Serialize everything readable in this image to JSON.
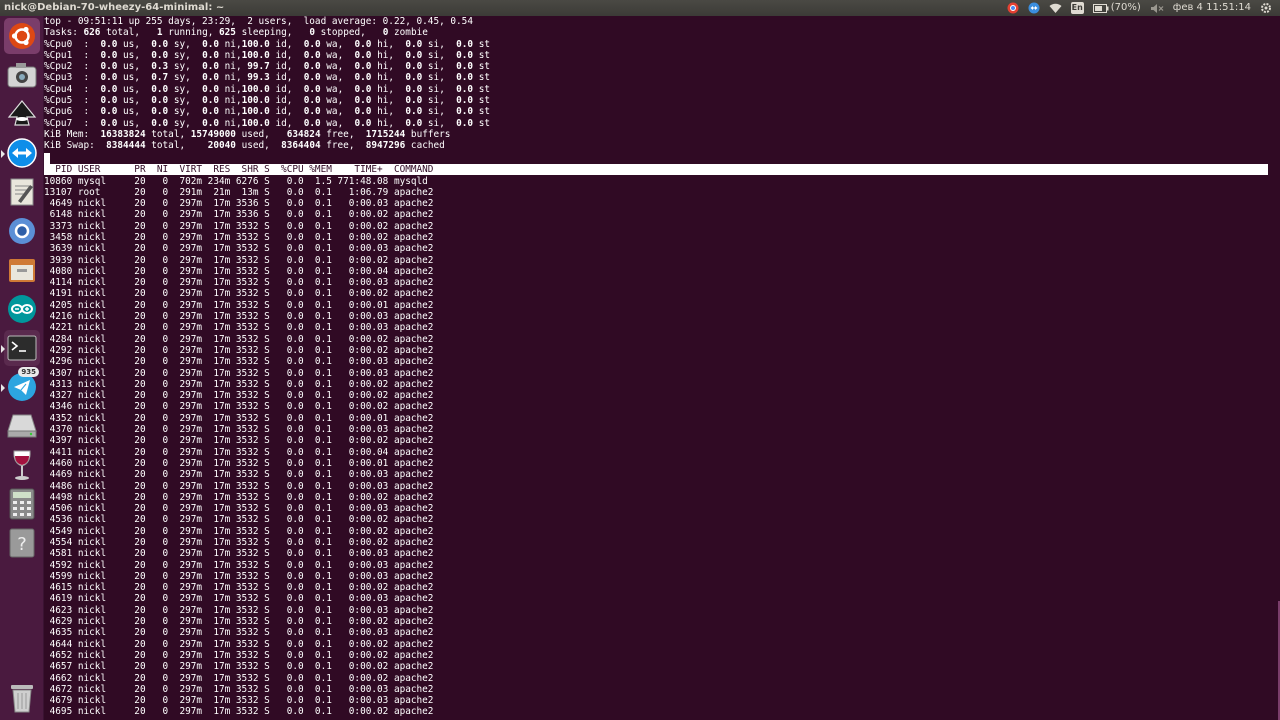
{
  "window": {
    "title": "nick@Debian-70-wheezy-64-minimal: ~"
  },
  "panel": {
    "battery": "(70%)",
    "keyboard_layout": "En",
    "datetime": "фев 4 11:51:14",
    "indicators": [
      "chrome-indicator-icon",
      "teamviewer-indicator-icon",
      "wifi-icon",
      "keyboard-layout-icon",
      "battery-icon",
      "volume-muted-icon",
      "power-gear-icon"
    ]
  },
  "launcher": {
    "items": [
      {
        "name": "ubuntu-dash-icon",
        "color": "#dd4814"
      },
      {
        "name": "screenshot-camera-icon",
        "color": "#9e9e9e"
      },
      {
        "name": "inkscape-icon",
        "color": "#222222"
      },
      {
        "name": "teamviewer-icon",
        "color": "#0e8ee9"
      },
      {
        "name": "text-editor-icon",
        "color": "#d8d4c8"
      },
      {
        "name": "chromium-icon",
        "color": "#5b8fd6"
      },
      {
        "name": "file-manager-icon",
        "color": "#cf7a36"
      },
      {
        "name": "arduino-icon",
        "color": "#00979c"
      },
      {
        "name": "terminal-icon",
        "color": "#2c2c2c"
      },
      {
        "name": "telegram-icon",
        "color": "#2ca5e0",
        "badge": "935"
      },
      {
        "name": "drive-icon",
        "color": "#bdbdbd"
      },
      {
        "name": "wine-icon",
        "color": "#e0e0e0"
      },
      {
        "name": "calculator-icon",
        "color": "#8a8a8a"
      },
      {
        "name": "help-icon",
        "color": "#9a9a9a"
      },
      {
        "name": "trash-icon",
        "color": "#aaaaaa"
      }
    ]
  },
  "top": {
    "summary_lines": [
      "top - 09:51:11 up 255 days, 23:29,  2 users,  load average: 0.22, 0.45, 0.54",
      "Tasks: 626 total,   1 running, 625 sleeping,   0 stopped,   0 zombie",
      "%Cpu0  :  0.0 us,  0.0 sy,  0.0 ni,100.0 id,  0.0 wa,  0.0 hi,  0.0 si,  0.0 st",
      "%Cpu1  :  0.0 us,  0.0 sy,  0.0 ni,100.0 id,  0.0 wa,  0.0 hi,  0.0 si,  0.0 st",
      "%Cpu2  :  0.0 us,  0.3 sy,  0.0 ni, 99.7 id,  0.0 wa,  0.0 hi,  0.0 si,  0.0 st",
      "%Cpu3  :  0.0 us,  0.7 sy,  0.0 ni, 99.3 id,  0.0 wa,  0.0 hi,  0.0 si,  0.0 st",
      "%Cpu4  :  0.0 us,  0.0 sy,  0.0 ni,100.0 id,  0.0 wa,  0.0 hi,  0.0 si,  0.0 st",
      "%Cpu5  :  0.0 us,  0.0 sy,  0.0 ni,100.0 id,  0.0 wa,  0.0 hi,  0.0 si,  0.0 st",
      "%Cpu6  :  0.0 us,  0.0 sy,  0.0 ni,100.0 id,  0.0 wa,  0.0 hi,  0.0 si,  0.0 st",
      "%Cpu7  :  0.0 us,  0.0 sy,  0.0 ni,100.0 id,  0.0 wa,  0.0 hi,  0.0 si,  0.0 st",
      "KiB Mem:  16383824 total, 15749000 used,   634824 free,  1715244 buffers",
      "KiB Swap:  8384444 total,    20040 used,  8364404 free,  8947296 cached"
    ],
    "header": "  PID USER      PR  NI  VIRT  RES  SHR S  %CPU %MEM    TIME+  COMMAND",
    "processes": [
      {
        "pid": "10860",
        "user": "mysql",
        "pr": "20",
        "ni": "0",
        "virt": "702m",
        "res": "234m",
        "shr": "6276",
        "s": "S",
        "cpu": "0.0",
        "mem": "1.5",
        "time": "771:48.08",
        "command": "mysqld"
      },
      {
        "pid": "13107",
        "user": "root",
        "pr": "20",
        "ni": "0",
        "virt": "291m",
        "res": "21m",
        "shr": "13m",
        "s": "S",
        "cpu": "0.0",
        "mem": "0.1",
        "time": "1:06.79",
        "command": "apache2"
      },
      {
        "pid": "4649",
        "user": "nickl",
        "pr": "20",
        "ni": "0",
        "virt": "297m",
        "res": "17m",
        "shr": "3536",
        "s": "S",
        "cpu": "0.0",
        "mem": "0.1",
        "time": "0:00.03",
        "command": "apache2"
      },
      {
        "pid": "6148",
        "user": "nickl",
        "pr": "20",
        "ni": "0",
        "virt": "297m",
        "res": "17m",
        "shr": "3536",
        "s": "S",
        "cpu": "0.0",
        "mem": "0.1",
        "time": "0:00.02",
        "command": "apache2"
      },
      {
        "pid": "3373",
        "user": "nickl",
        "pr": "20",
        "ni": "0",
        "virt": "297m",
        "res": "17m",
        "shr": "3532",
        "s": "S",
        "cpu": "0.0",
        "mem": "0.1",
        "time": "0:00.02",
        "command": "apache2"
      },
      {
        "pid": "3458",
        "user": "nickl",
        "pr": "20",
        "ni": "0",
        "virt": "297m",
        "res": "17m",
        "shr": "3532",
        "s": "S",
        "cpu": "0.0",
        "mem": "0.1",
        "time": "0:00.02",
        "command": "apache2"
      },
      {
        "pid": "3639",
        "user": "nickl",
        "pr": "20",
        "ni": "0",
        "virt": "297m",
        "res": "17m",
        "shr": "3532",
        "s": "S",
        "cpu": "0.0",
        "mem": "0.1",
        "time": "0:00.03",
        "command": "apache2"
      },
      {
        "pid": "3939",
        "user": "nickl",
        "pr": "20",
        "ni": "0",
        "virt": "297m",
        "res": "17m",
        "shr": "3532",
        "s": "S",
        "cpu": "0.0",
        "mem": "0.1",
        "time": "0:00.02",
        "command": "apache2"
      },
      {
        "pid": "4080",
        "user": "nickl",
        "pr": "20",
        "ni": "0",
        "virt": "297m",
        "res": "17m",
        "shr": "3532",
        "s": "S",
        "cpu": "0.0",
        "mem": "0.1",
        "time": "0:00.04",
        "command": "apache2"
      },
      {
        "pid": "4114",
        "user": "nickl",
        "pr": "20",
        "ni": "0",
        "virt": "297m",
        "res": "17m",
        "shr": "3532",
        "s": "S",
        "cpu": "0.0",
        "mem": "0.1",
        "time": "0:00.03",
        "command": "apache2"
      },
      {
        "pid": "4191",
        "user": "nickl",
        "pr": "20",
        "ni": "0",
        "virt": "297m",
        "res": "17m",
        "shr": "3532",
        "s": "S",
        "cpu": "0.0",
        "mem": "0.1",
        "time": "0:00.02",
        "command": "apache2"
      },
      {
        "pid": "4205",
        "user": "nickl",
        "pr": "20",
        "ni": "0",
        "virt": "297m",
        "res": "17m",
        "shr": "3532",
        "s": "S",
        "cpu": "0.0",
        "mem": "0.1",
        "time": "0:00.01",
        "command": "apache2"
      },
      {
        "pid": "4216",
        "user": "nickl",
        "pr": "20",
        "ni": "0",
        "virt": "297m",
        "res": "17m",
        "shr": "3532",
        "s": "S",
        "cpu": "0.0",
        "mem": "0.1",
        "time": "0:00.03",
        "command": "apache2"
      },
      {
        "pid": "4221",
        "user": "nickl",
        "pr": "20",
        "ni": "0",
        "virt": "297m",
        "res": "17m",
        "shr": "3532",
        "s": "S",
        "cpu": "0.0",
        "mem": "0.1",
        "time": "0:00.03",
        "command": "apache2"
      },
      {
        "pid": "4284",
        "user": "nickl",
        "pr": "20",
        "ni": "0",
        "virt": "297m",
        "res": "17m",
        "shr": "3532",
        "s": "S",
        "cpu": "0.0",
        "mem": "0.1",
        "time": "0:00.02",
        "command": "apache2"
      },
      {
        "pid": "4292",
        "user": "nickl",
        "pr": "20",
        "ni": "0",
        "virt": "297m",
        "res": "17m",
        "shr": "3532",
        "s": "S",
        "cpu": "0.0",
        "mem": "0.1",
        "time": "0:00.02",
        "command": "apache2"
      },
      {
        "pid": "4296",
        "user": "nickl",
        "pr": "20",
        "ni": "0",
        "virt": "297m",
        "res": "17m",
        "shr": "3532",
        "s": "S",
        "cpu": "0.0",
        "mem": "0.1",
        "time": "0:00.03",
        "command": "apache2"
      },
      {
        "pid": "4307",
        "user": "nickl",
        "pr": "20",
        "ni": "0",
        "virt": "297m",
        "res": "17m",
        "shr": "3532",
        "s": "S",
        "cpu": "0.0",
        "mem": "0.1",
        "time": "0:00.03",
        "command": "apache2"
      },
      {
        "pid": "4313",
        "user": "nickl",
        "pr": "20",
        "ni": "0",
        "virt": "297m",
        "res": "17m",
        "shr": "3532",
        "s": "S",
        "cpu": "0.0",
        "mem": "0.1",
        "time": "0:00.02",
        "command": "apache2"
      },
      {
        "pid": "4327",
        "user": "nickl",
        "pr": "20",
        "ni": "0",
        "virt": "297m",
        "res": "17m",
        "shr": "3532",
        "s": "S",
        "cpu": "0.0",
        "mem": "0.1",
        "time": "0:00.02",
        "command": "apache2"
      },
      {
        "pid": "4346",
        "user": "nickl",
        "pr": "20",
        "ni": "0",
        "virt": "297m",
        "res": "17m",
        "shr": "3532",
        "s": "S",
        "cpu": "0.0",
        "mem": "0.1",
        "time": "0:00.02",
        "command": "apache2"
      },
      {
        "pid": "4352",
        "user": "nickl",
        "pr": "20",
        "ni": "0",
        "virt": "297m",
        "res": "17m",
        "shr": "3532",
        "s": "S",
        "cpu": "0.0",
        "mem": "0.1",
        "time": "0:00.01",
        "command": "apache2"
      },
      {
        "pid": "4370",
        "user": "nickl",
        "pr": "20",
        "ni": "0",
        "virt": "297m",
        "res": "17m",
        "shr": "3532",
        "s": "S",
        "cpu": "0.0",
        "mem": "0.1",
        "time": "0:00.03",
        "command": "apache2"
      },
      {
        "pid": "4397",
        "user": "nickl",
        "pr": "20",
        "ni": "0",
        "virt": "297m",
        "res": "17m",
        "shr": "3532",
        "s": "S",
        "cpu": "0.0",
        "mem": "0.1",
        "time": "0:00.02",
        "command": "apache2"
      },
      {
        "pid": "4411",
        "user": "nickl",
        "pr": "20",
        "ni": "0",
        "virt": "297m",
        "res": "17m",
        "shr": "3532",
        "s": "S",
        "cpu": "0.0",
        "mem": "0.1",
        "time": "0:00.04",
        "command": "apache2"
      },
      {
        "pid": "4460",
        "user": "nickl",
        "pr": "20",
        "ni": "0",
        "virt": "297m",
        "res": "17m",
        "shr": "3532",
        "s": "S",
        "cpu": "0.0",
        "mem": "0.1",
        "time": "0:00.01",
        "command": "apache2"
      },
      {
        "pid": "4469",
        "user": "nickl",
        "pr": "20",
        "ni": "0",
        "virt": "297m",
        "res": "17m",
        "shr": "3532",
        "s": "S",
        "cpu": "0.0",
        "mem": "0.1",
        "time": "0:00.03",
        "command": "apache2"
      },
      {
        "pid": "4486",
        "user": "nickl",
        "pr": "20",
        "ni": "0",
        "virt": "297m",
        "res": "17m",
        "shr": "3532",
        "s": "S",
        "cpu": "0.0",
        "mem": "0.1",
        "time": "0:00.03",
        "command": "apache2"
      },
      {
        "pid": "4498",
        "user": "nickl",
        "pr": "20",
        "ni": "0",
        "virt": "297m",
        "res": "17m",
        "shr": "3532",
        "s": "S",
        "cpu": "0.0",
        "mem": "0.1",
        "time": "0:00.02",
        "command": "apache2"
      },
      {
        "pid": "4506",
        "user": "nickl",
        "pr": "20",
        "ni": "0",
        "virt": "297m",
        "res": "17m",
        "shr": "3532",
        "s": "S",
        "cpu": "0.0",
        "mem": "0.1",
        "time": "0:00.03",
        "command": "apache2"
      },
      {
        "pid": "4536",
        "user": "nickl",
        "pr": "20",
        "ni": "0",
        "virt": "297m",
        "res": "17m",
        "shr": "3532",
        "s": "S",
        "cpu": "0.0",
        "mem": "0.1",
        "time": "0:00.02",
        "command": "apache2"
      },
      {
        "pid": "4549",
        "user": "nickl",
        "pr": "20",
        "ni": "0",
        "virt": "297m",
        "res": "17m",
        "shr": "3532",
        "s": "S",
        "cpu": "0.0",
        "mem": "0.1",
        "time": "0:00.02",
        "command": "apache2"
      },
      {
        "pid": "4554",
        "user": "nickl",
        "pr": "20",
        "ni": "0",
        "virt": "297m",
        "res": "17m",
        "shr": "3532",
        "s": "S",
        "cpu": "0.0",
        "mem": "0.1",
        "time": "0:00.02",
        "command": "apache2"
      },
      {
        "pid": "4581",
        "user": "nickl",
        "pr": "20",
        "ni": "0",
        "virt": "297m",
        "res": "17m",
        "shr": "3532",
        "s": "S",
        "cpu": "0.0",
        "mem": "0.1",
        "time": "0:00.03",
        "command": "apache2"
      },
      {
        "pid": "4592",
        "user": "nickl",
        "pr": "20",
        "ni": "0",
        "virt": "297m",
        "res": "17m",
        "shr": "3532",
        "s": "S",
        "cpu": "0.0",
        "mem": "0.1",
        "time": "0:00.03",
        "command": "apache2"
      },
      {
        "pid": "4599",
        "user": "nickl",
        "pr": "20",
        "ni": "0",
        "virt": "297m",
        "res": "17m",
        "shr": "3532",
        "s": "S",
        "cpu": "0.0",
        "mem": "0.1",
        "time": "0:00.03",
        "command": "apache2"
      },
      {
        "pid": "4615",
        "user": "nickl",
        "pr": "20",
        "ni": "0",
        "virt": "297m",
        "res": "17m",
        "shr": "3532",
        "s": "S",
        "cpu": "0.0",
        "mem": "0.1",
        "time": "0:00.02",
        "command": "apache2"
      },
      {
        "pid": "4619",
        "user": "nickl",
        "pr": "20",
        "ni": "0",
        "virt": "297m",
        "res": "17m",
        "shr": "3532",
        "s": "S",
        "cpu": "0.0",
        "mem": "0.1",
        "time": "0:00.03",
        "command": "apache2"
      },
      {
        "pid": "4623",
        "user": "nickl",
        "pr": "20",
        "ni": "0",
        "virt": "297m",
        "res": "17m",
        "shr": "3532",
        "s": "S",
        "cpu": "0.0",
        "mem": "0.1",
        "time": "0:00.03",
        "command": "apache2"
      },
      {
        "pid": "4629",
        "user": "nickl",
        "pr": "20",
        "ni": "0",
        "virt": "297m",
        "res": "17m",
        "shr": "3532",
        "s": "S",
        "cpu": "0.0",
        "mem": "0.1",
        "time": "0:00.02",
        "command": "apache2"
      },
      {
        "pid": "4635",
        "user": "nickl",
        "pr": "20",
        "ni": "0",
        "virt": "297m",
        "res": "17m",
        "shr": "3532",
        "s": "S",
        "cpu": "0.0",
        "mem": "0.1",
        "time": "0:00.03",
        "command": "apache2"
      },
      {
        "pid": "4644",
        "user": "nickl",
        "pr": "20",
        "ni": "0",
        "virt": "297m",
        "res": "17m",
        "shr": "3532",
        "s": "S",
        "cpu": "0.0",
        "mem": "0.1",
        "time": "0:00.02",
        "command": "apache2"
      },
      {
        "pid": "4652",
        "user": "nickl",
        "pr": "20",
        "ni": "0",
        "virt": "297m",
        "res": "17m",
        "shr": "3532",
        "s": "S",
        "cpu": "0.0",
        "mem": "0.1",
        "time": "0:00.02",
        "command": "apache2"
      },
      {
        "pid": "4657",
        "user": "nickl",
        "pr": "20",
        "ni": "0",
        "virt": "297m",
        "res": "17m",
        "shr": "3532",
        "s": "S",
        "cpu": "0.0",
        "mem": "0.1",
        "time": "0:00.02",
        "command": "apache2"
      },
      {
        "pid": "4662",
        "user": "nickl",
        "pr": "20",
        "ni": "0",
        "virt": "297m",
        "res": "17m",
        "shr": "3532",
        "s": "S",
        "cpu": "0.0",
        "mem": "0.1",
        "time": "0:00.02",
        "command": "apache2"
      },
      {
        "pid": "4672",
        "user": "nickl",
        "pr": "20",
        "ni": "0",
        "virt": "297m",
        "res": "17m",
        "shr": "3532",
        "s": "S",
        "cpu": "0.0",
        "mem": "0.1",
        "time": "0:00.03",
        "command": "apache2"
      },
      {
        "pid": "4679",
        "user": "nickl",
        "pr": "20",
        "ni": "0",
        "virt": "297m",
        "res": "17m",
        "shr": "3532",
        "s": "S",
        "cpu": "0.0",
        "mem": "0.1",
        "time": "0:00.03",
        "command": "apache2"
      },
      {
        "pid": "4695",
        "user": "nickl",
        "pr": "20",
        "ni": "0",
        "virt": "297m",
        "res": "17m",
        "shr": "3532",
        "s": "S",
        "cpu": "0.0",
        "mem": "0.1",
        "time": "0:00.02",
        "command": "apache2"
      }
    ]
  }
}
